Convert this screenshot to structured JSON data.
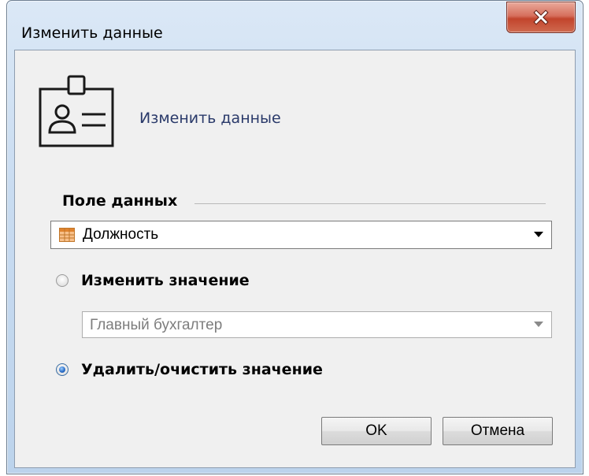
{
  "window": {
    "title": "Изменить данные",
    "close_icon": "close-icon"
  },
  "header": {
    "icon": "id-badge-icon",
    "title": "Изменить данные"
  },
  "data_field_group": {
    "label": "Поле данных",
    "selected_field": "Должность",
    "field_icon": "table-icon"
  },
  "options": {
    "change_value": {
      "label": "Изменить значение",
      "selected": false,
      "value": "Главный бухгалтер"
    },
    "clear_value": {
      "label": "Удалить/очистить значение",
      "selected": true
    }
  },
  "buttons": {
    "ok_label": "OK",
    "cancel_label": "Отмена"
  },
  "colors": {
    "close_button": "#c2442c",
    "title_gradient": "#c9dcf1",
    "client_bg": "#f0f0f0",
    "header_text": "#2a3a6a"
  }
}
